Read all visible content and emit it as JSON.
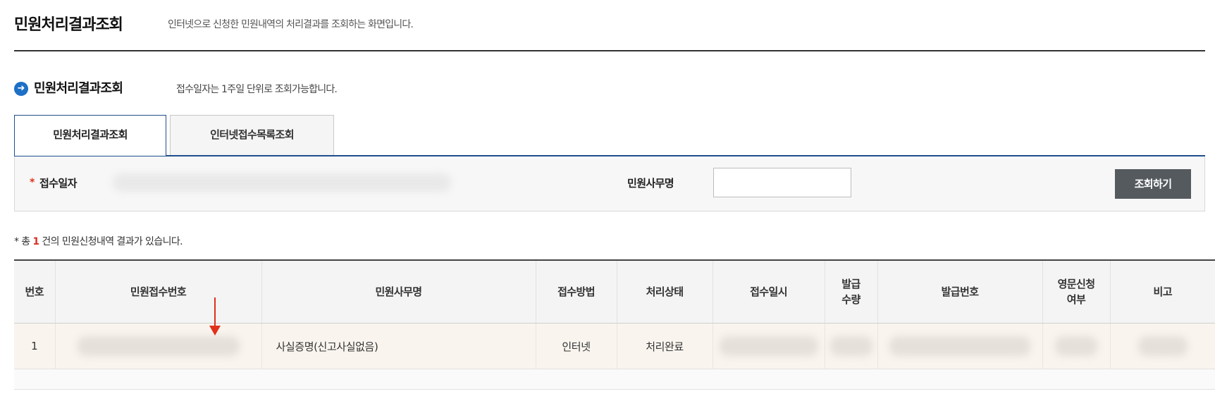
{
  "header": {
    "title": "민원처리결과조회",
    "description": "인터넷으로 신청한 민원내역의 처리결과를 조회하는 화면입니다."
  },
  "section": {
    "icon": "arrow-right-circle-icon",
    "title": "민원처리결과조회",
    "description": "접수일자는 1주일 단위로 조회가능합니다."
  },
  "tabs": [
    {
      "label": "민원처리결과조회",
      "active": true
    },
    {
      "label": "인터넷접수목록조회",
      "active": false
    }
  ],
  "search": {
    "required_mark": "*",
    "date_label": "접수일자",
    "office_label": "민원사무명",
    "office_value": "",
    "button_label": "조회하기"
  },
  "result": {
    "prefix": "* 총",
    "count": "1",
    "suffix": "건의 민원신청내역 결과가 있습니다."
  },
  "table": {
    "headers": [
      "번호",
      "민원접수번호",
      "민원사무명",
      "접수방법",
      "처리상태",
      "접수일시",
      "발급\n수량",
      "발급번호",
      "영문신청\n여부",
      "비고"
    ],
    "rows": [
      {
        "no": "1",
        "receipt_no": "",
        "office": "사실증명(신고사실없음)",
        "method": "인터넷",
        "status": "처리완료"
      }
    ]
  },
  "colors": {
    "accent_blue": "#1f4e8c",
    "annotation_red": "#e0311c",
    "button_gray": "#555a5f"
  }
}
